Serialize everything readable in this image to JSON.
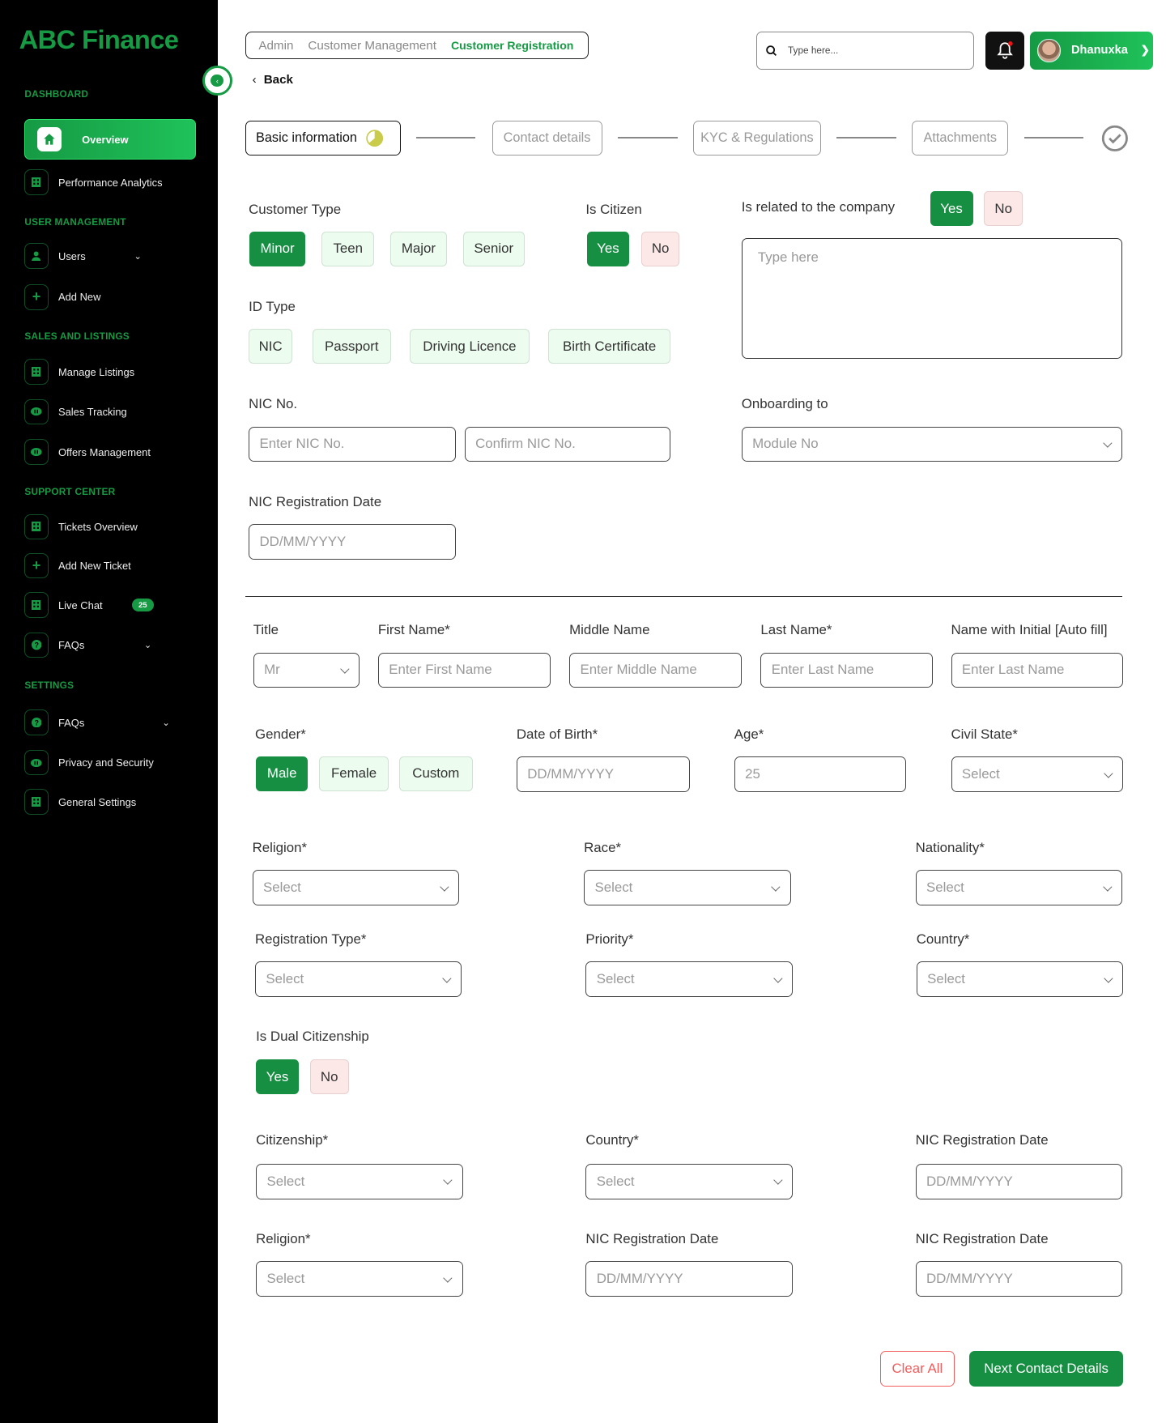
{
  "brand": "ABC Finance",
  "sidebar": {
    "sections": [
      "DASHBOARD",
      "USER MANAGEMENT",
      "SALES AND LISTINGS",
      "SUPPORT CENTER",
      "SETTINGS"
    ],
    "items": {
      "overview": "Overview",
      "performance": "Performance Analytics",
      "users": "Users",
      "add_new": "Add New",
      "manage_listings": "Manage Listings",
      "sales_tracking": "Sales Tracking",
      "offers": "Offers Management",
      "tickets": "Tickets Overview",
      "add_ticket": "Add New Ticket",
      "live_chat": "Live Chat",
      "live_chat_badge": "25",
      "faqs_support": "FAQs",
      "faqs_settings": "FAQs",
      "privacy": "Privacy and Security",
      "general": "General Settings"
    }
  },
  "header": {
    "breadcrumb": [
      "Admin",
      "Customer Management",
      "Customer Registration"
    ],
    "search_placeholder": "Type here...",
    "user_name": "Dhanuxka",
    "back": "Back"
  },
  "stepper": [
    "Basic information",
    "Contact details",
    "KYC & Regulations",
    "Attachments"
  ],
  "form": {
    "customer_type": {
      "label": "Customer Type",
      "options": [
        "Minor",
        "Teen",
        "Major",
        "Senior"
      ],
      "selected": "Minor"
    },
    "is_citizen": {
      "label": "Is Citizen",
      "yes": "Yes",
      "no": "No",
      "selected": "Yes"
    },
    "is_related": {
      "label": "Is related to the company",
      "yes": "Yes",
      "no": "No",
      "selected": "Yes",
      "placeholder": "Type here"
    },
    "id_type": {
      "label": "ID Type",
      "options": [
        "NIC",
        "Passport",
        "Driving Licence",
        "Birth Certificate"
      ]
    },
    "nic_no": {
      "label": "NIC No.",
      "placeholder": "Enter NIC No.",
      "confirm_placeholder": "Confirm NIC No."
    },
    "onboarding": {
      "label": "Onboarding to",
      "value": "Module No"
    },
    "nic_reg_date": {
      "label": "NIC Registration Date",
      "placeholder": "DD/MM/YYYY"
    },
    "title": {
      "label": "Title",
      "value": "Mr"
    },
    "first_name": {
      "label": "First Name*",
      "placeholder": "Enter First Name"
    },
    "middle_name": {
      "label": "Middle Name",
      "placeholder": "Enter Middle Name"
    },
    "last_name": {
      "label": "Last Name*",
      "placeholder": "Enter Last Name"
    },
    "name_initial": {
      "label": "Name with Initial [Auto fill]",
      "placeholder": "Enter Last Name"
    },
    "gender": {
      "label": "Gender*",
      "options": [
        "Male",
        "Female",
        "Custom"
      ],
      "selected": "Male"
    },
    "dob": {
      "label": "Date of Birth*",
      "placeholder": "DD/MM/YYYY"
    },
    "age": {
      "label": "Age*",
      "value": "25"
    },
    "civil_state": {
      "label": "Civil State*",
      "value": "Select"
    },
    "religion": {
      "label": "Religion*",
      "value": "Select"
    },
    "race": {
      "label": "Race*",
      "value": "Select"
    },
    "nationality": {
      "label": "Nationality*",
      "value": "Select"
    },
    "registration_type": {
      "label": "Registration Type*",
      "value": "Select"
    },
    "priority": {
      "label": "Priority*",
      "value": "Select"
    },
    "country": {
      "label": "Country*",
      "value": "Select"
    },
    "dual": {
      "label": "Is Dual Citizenship",
      "yes": "Yes",
      "no": "No",
      "selected": "Yes"
    },
    "citizenship": {
      "label": "Citizenship*",
      "value": "Select"
    },
    "country2": {
      "label": "Country*",
      "value": "Select"
    },
    "nic_reg_date2": {
      "label": "NIC Registration Date",
      "placeholder": "DD/MM/YYYY"
    },
    "religion2": {
      "label": "Religion*",
      "value": "Select"
    },
    "nic_reg_date3": {
      "label": "NIC Registration Date",
      "placeholder": "DD/MM/YYYY"
    },
    "nic_reg_date4": {
      "label": "NIC Registration Date",
      "placeholder": "DD/MM/YYYY"
    }
  },
  "actions": {
    "clear": "Clear All",
    "next": "Next Contact Details"
  },
  "colors": {
    "primary": "#168f42",
    "danger": "#f15c5c",
    "sidebar": "#000000"
  }
}
